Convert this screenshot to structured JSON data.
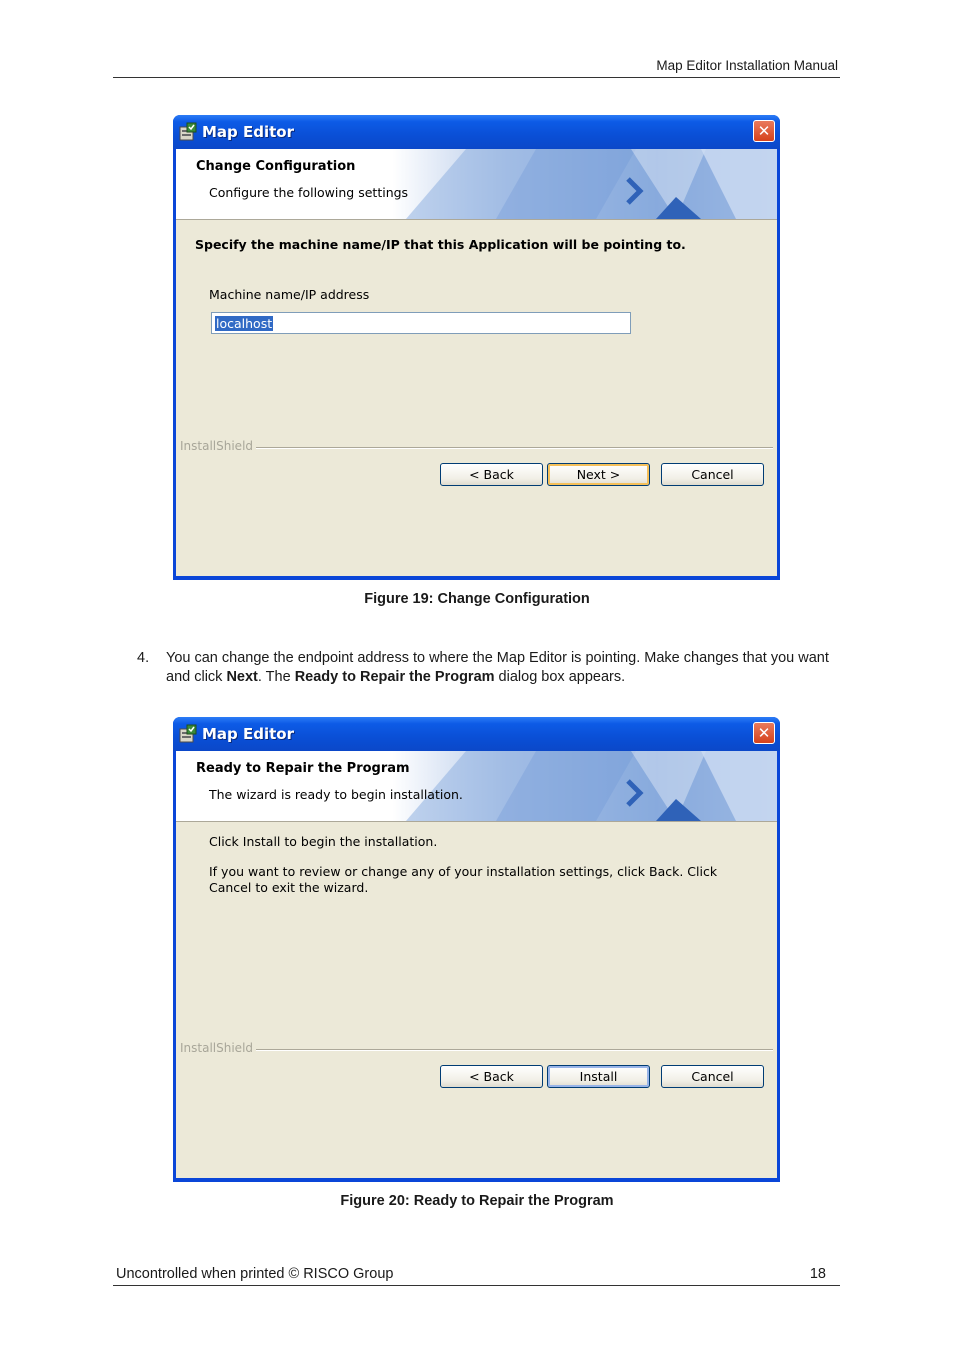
{
  "page": {
    "header": "Map Editor Installation Manual",
    "footer_left": "Uncontrolled when printed © RISCO Group",
    "page_number": "18"
  },
  "dialog1": {
    "title": "Map Editor",
    "banner_title": "Change Configuration",
    "banner_subtitle": "Configure the following settings",
    "instruction": "Specify the machine name/IP that this Application will be pointing to.",
    "field_label": "Machine name/IP address",
    "field_value": "localhost",
    "brand": "InstallShield",
    "buttons": {
      "back": "< Back",
      "next": "Next >",
      "cancel": "Cancel"
    },
    "caption": "Figure 19: Change Configuration"
  },
  "step": {
    "number": "4.",
    "text_1": "You can change the endpoint address to where the Map Editor is pointing. Make changes that you want and click ",
    "bold_1": "Next",
    "text_2": ". The ",
    "bold_2": "Ready to Repair the Program",
    "text_3": " dialog box appears."
  },
  "dialog2": {
    "title": "Map Editor",
    "banner_title": "Ready to Repair the Program",
    "banner_subtitle": "The wizard is ready to begin installation.",
    "line1": "Click Install to begin the installation.",
    "line2": "If you want to review or change any of your installation settings, click Back. Click Cancel to exit the wizard.",
    "brand": "InstallShield",
    "buttons": {
      "back": "< Back",
      "install": "Install",
      "cancel": "Cancel"
    },
    "caption": "Figure 20: Ready to Repair the Program"
  },
  "colors": {
    "titlebar": "#0a4fd6",
    "dialog_bg": "#ece9d8",
    "close": "#d6421c"
  },
  "icons": [
    "installer-app-icon",
    "close-icon",
    "banner-chevron-icon"
  ]
}
